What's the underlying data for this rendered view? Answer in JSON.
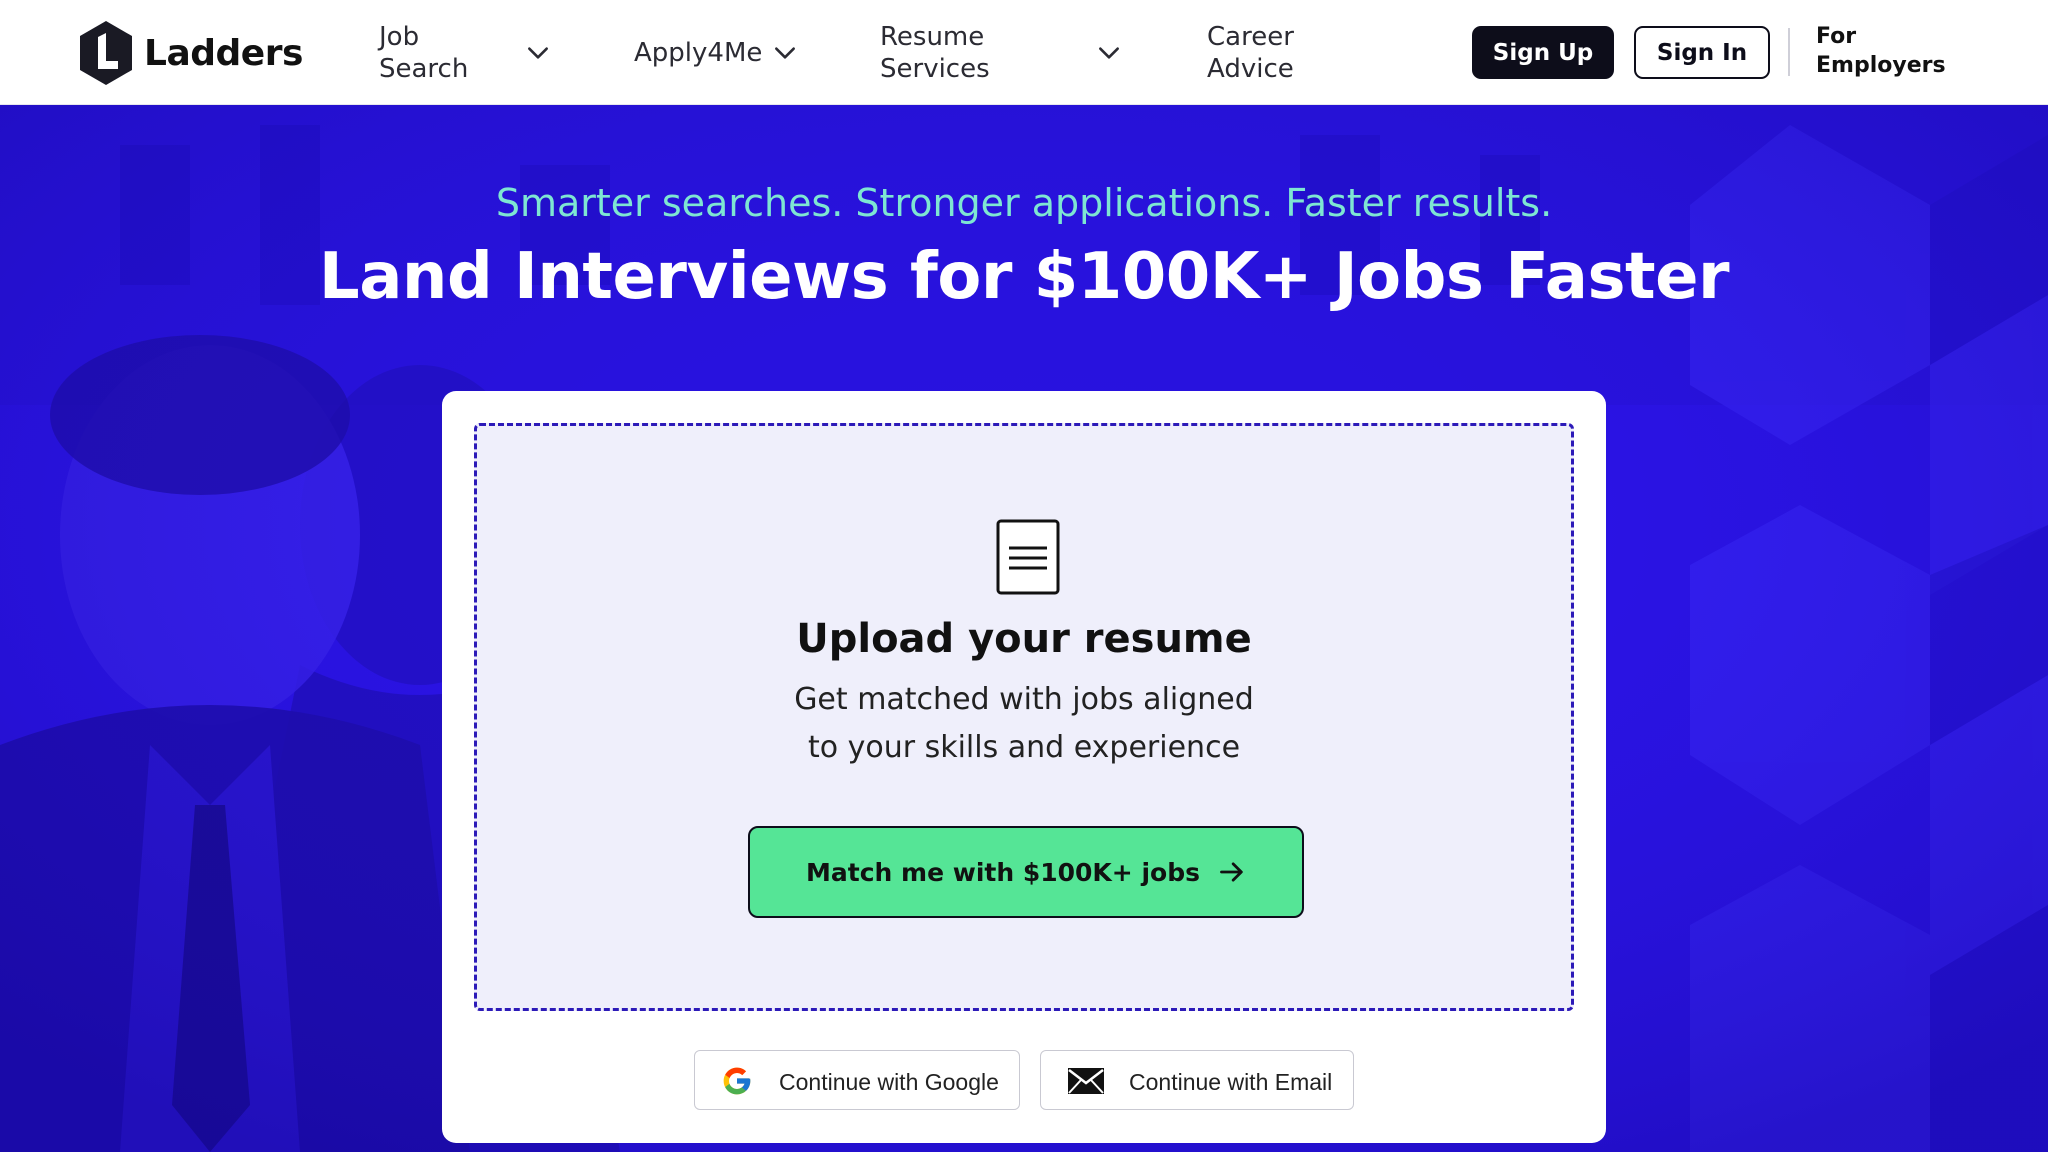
{
  "header": {
    "logo_text": "Ladders",
    "nav": {
      "job_search_line1": "Job",
      "job_search_line2": "Search",
      "apply4me": "Apply4Me",
      "resume_services_line1": "Resume",
      "resume_services_line2": "Services",
      "career_advice_line1": "Career",
      "career_advice_line2": "Advice"
    },
    "sign_up": "Sign Up",
    "sign_in": "Sign In",
    "for_employers_line1": "For",
    "for_employers_line2": "Employers"
  },
  "hero": {
    "tagline": "Smarter searches. Stronger applications. Faster results.",
    "headline": "Land Interviews for $100K+ Jobs Faster"
  },
  "upload": {
    "title": "Upload your resume",
    "subtitle_line1": "Get matched with jobs aligned",
    "subtitle_line2": "to your skills and experience",
    "cta": "Match me with $100K+ jobs"
  },
  "auth": {
    "google": "Continue with Google",
    "email": "Continue with Email"
  },
  "colors": {
    "hero_bg": "#2a12e8",
    "tagline": "#7ee6d2",
    "cta_bg": "#55e596",
    "dark": "#0d0d1a"
  },
  "icons": {
    "logo": "ladders-hexagon-logo",
    "nav_dropdown": "chevron-down-icon",
    "document": "document-icon",
    "cta_arrow": "arrow-right-icon",
    "google": "google-icon",
    "email": "envelope-icon"
  }
}
